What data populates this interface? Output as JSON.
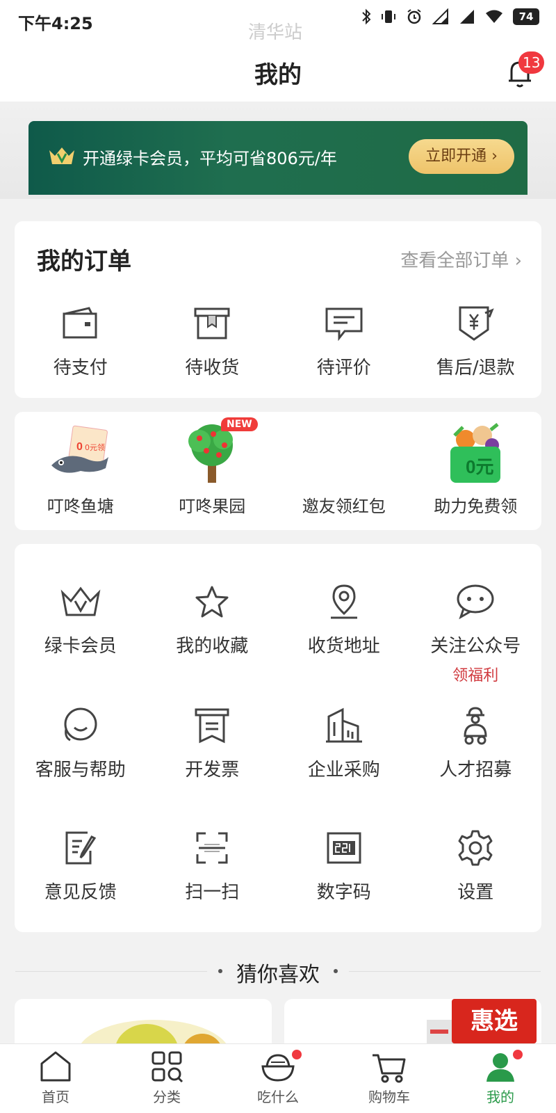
{
  "status_bar": {
    "time": "下午4:25",
    "station": "清华站",
    "battery": "74"
  },
  "header": {
    "title": "我的",
    "notification_count": "13"
  },
  "banner": {
    "text": "开通绿卡会员，平均可省806元/年",
    "button": "立即开通"
  },
  "orders": {
    "title": "我的订单",
    "view_all": "查看全部订单",
    "items": [
      {
        "label": "待支付",
        "icon": "wallet-icon"
      },
      {
        "label": "待收货",
        "icon": "box-icon"
      },
      {
        "label": "待评价",
        "icon": "comment-icon"
      },
      {
        "label": "售后/退款",
        "icon": "refund-icon"
      }
    ]
  },
  "activities": {
    "new_badge": "NEW",
    "items": [
      {
        "label": "叮咚鱼塘",
        "icon": "fish-pond-icon",
        "tag": "0元领"
      },
      {
        "label": "叮咚果园",
        "icon": "fruit-tree-icon"
      },
      {
        "label": "邀友领红包",
        "icon": "red-packet-icon"
      },
      {
        "label": "助力免费领",
        "icon": "vegetable-basket-icon",
        "tag": "0元"
      }
    ]
  },
  "tools": {
    "rows": [
      [
        {
          "label": "绿卡会员",
          "icon": "crown-icon"
        },
        {
          "label": "我的收藏",
          "icon": "star-icon"
        },
        {
          "label": "收货地址",
          "icon": "location-icon"
        },
        {
          "label": "关注公众号",
          "icon": "chat-bubble-icon",
          "sub": "领福利"
        }
      ],
      [
        {
          "label": "客服与帮助",
          "icon": "customer-service-icon"
        },
        {
          "label": "开发票",
          "icon": "invoice-icon"
        },
        {
          "label": "企业采购",
          "icon": "building-icon"
        },
        {
          "label": "人才招募",
          "icon": "courier-icon"
        }
      ],
      [
        {
          "label": "意见反馈",
          "icon": "feedback-icon"
        },
        {
          "label": "扫一扫",
          "icon": "scan-icon"
        },
        {
          "label": "数字码",
          "icon": "digital-code-icon"
        },
        {
          "label": "设置",
          "icon": "gear-icon"
        }
      ]
    ]
  },
  "recommend": {
    "title": "猜你喜欢",
    "promo_badge": "惠选"
  },
  "tabbar": {
    "items": [
      {
        "label": "首页",
        "icon": "home-icon"
      },
      {
        "label": "分类",
        "icon": "category-icon"
      },
      {
        "label": "吃什么",
        "icon": "bowl-icon"
      },
      {
        "label": "购物车",
        "icon": "cart-icon"
      },
      {
        "label": "我的",
        "icon": "profile-icon"
      }
    ],
    "active_index": 4
  },
  "colors": {
    "accent_green": "#2a9a4a",
    "badge_red": "#f0383f",
    "banner_green": "#1f6e4f",
    "gold": "#eec36a"
  }
}
